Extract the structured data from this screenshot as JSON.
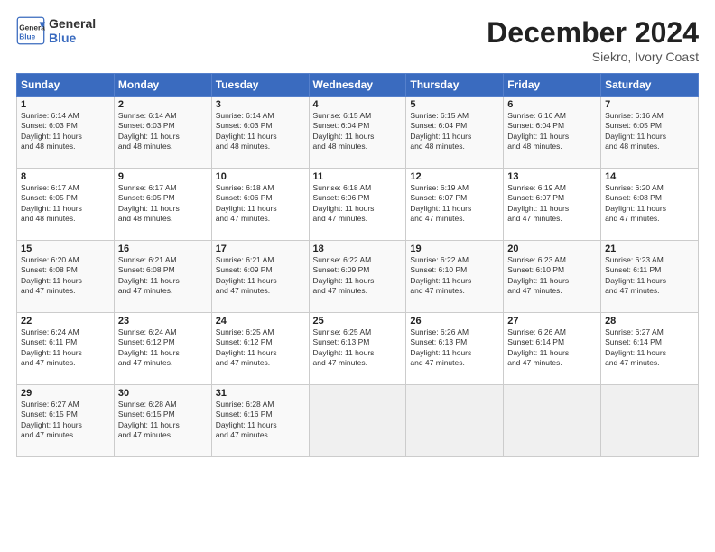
{
  "header": {
    "logo_line1": "General",
    "logo_line2": "Blue",
    "title": "December 2024",
    "subtitle": "Siekro, Ivory Coast"
  },
  "days_of_week": [
    "Sunday",
    "Monday",
    "Tuesday",
    "Wednesday",
    "Thursday",
    "Friday",
    "Saturday"
  ],
  "weeks": [
    [
      {
        "day": "1",
        "info": "Sunrise: 6:14 AM\nSunset: 6:03 PM\nDaylight: 11 hours\nand 48 minutes."
      },
      {
        "day": "2",
        "info": "Sunrise: 6:14 AM\nSunset: 6:03 PM\nDaylight: 11 hours\nand 48 minutes."
      },
      {
        "day": "3",
        "info": "Sunrise: 6:14 AM\nSunset: 6:03 PM\nDaylight: 11 hours\nand 48 minutes."
      },
      {
        "day": "4",
        "info": "Sunrise: 6:15 AM\nSunset: 6:04 PM\nDaylight: 11 hours\nand 48 minutes."
      },
      {
        "day": "5",
        "info": "Sunrise: 6:15 AM\nSunset: 6:04 PM\nDaylight: 11 hours\nand 48 minutes."
      },
      {
        "day": "6",
        "info": "Sunrise: 6:16 AM\nSunset: 6:04 PM\nDaylight: 11 hours\nand 48 minutes."
      },
      {
        "day": "7",
        "info": "Sunrise: 6:16 AM\nSunset: 6:05 PM\nDaylight: 11 hours\nand 48 minutes."
      }
    ],
    [
      {
        "day": "8",
        "info": "Sunrise: 6:17 AM\nSunset: 6:05 PM\nDaylight: 11 hours\nand 48 minutes."
      },
      {
        "day": "9",
        "info": "Sunrise: 6:17 AM\nSunset: 6:05 PM\nDaylight: 11 hours\nand 48 minutes."
      },
      {
        "day": "10",
        "info": "Sunrise: 6:18 AM\nSunset: 6:06 PM\nDaylight: 11 hours\nand 47 minutes."
      },
      {
        "day": "11",
        "info": "Sunrise: 6:18 AM\nSunset: 6:06 PM\nDaylight: 11 hours\nand 47 minutes."
      },
      {
        "day": "12",
        "info": "Sunrise: 6:19 AM\nSunset: 6:07 PM\nDaylight: 11 hours\nand 47 minutes."
      },
      {
        "day": "13",
        "info": "Sunrise: 6:19 AM\nSunset: 6:07 PM\nDaylight: 11 hours\nand 47 minutes."
      },
      {
        "day": "14",
        "info": "Sunrise: 6:20 AM\nSunset: 6:08 PM\nDaylight: 11 hours\nand 47 minutes."
      }
    ],
    [
      {
        "day": "15",
        "info": "Sunrise: 6:20 AM\nSunset: 6:08 PM\nDaylight: 11 hours\nand 47 minutes."
      },
      {
        "day": "16",
        "info": "Sunrise: 6:21 AM\nSunset: 6:08 PM\nDaylight: 11 hours\nand 47 minutes."
      },
      {
        "day": "17",
        "info": "Sunrise: 6:21 AM\nSunset: 6:09 PM\nDaylight: 11 hours\nand 47 minutes."
      },
      {
        "day": "18",
        "info": "Sunrise: 6:22 AM\nSunset: 6:09 PM\nDaylight: 11 hours\nand 47 minutes."
      },
      {
        "day": "19",
        "info": "Sunrise: 6:22 AM\nSunset: 6:10 PM\nDaylight: 11 hours\nand 47 minutes."
      },
      {
        "day": "20",
        "info": "Sunrise: 6:23 AM\nSunset: 6:10 PM\nDaylight: 11 hours\nand 47 minutes."
      },
      {
        "day": "21",
        "info": "Sunrise: 6:23 AM\nSunset: 6:11 PM\nDaylight: 11 hours\nand 47 minutes."
      }
    ],
    [
      {
        "day": "22",
        "info": "Sunrise: 6:24 AM\nSunset: 6:11 PM\nDaylight: 11 hours\nand 47 minutes."
      },
      {
        "day": "23",
        "info": "Sunrise: 6:24 AM\nSunset: 6:12 PM\nDaylight: 11 hours\nand 47 minutes."
      },
      {
        "day": "24",
        "info": "Sunrise: 6:25 AM\nSunset: 6:12 PM\nDaylight: 11 hours\nand 47 minutes."
      },
      {
        "day": "25",
        "info": "Sunrise: 6:25 AM\nSunset: 6:13 PM\nDaylight: 11 hours\nand 47 minutes."
      },
      {
        "day": "26",
        "info": "Sunrise: 6:26 AM\nSunset: 6:13 PM\nDaylight: 11 hours\nand 47 minutes."
      },
      {
        "day": "27",
        "info": "Sunrise: 6:26 AM\nSunset: 6:14 PM\nDaylight: 11 hours\nand 47 minutes."
      },
      {
        "day": "28",
        "info": "Sunrise: 6:27 AM\nSunset: 6:14 PM\nDaylight: 11 hours\nand 47 minutes."
      }
    ],
    [
      {
        "day": "29",
        "info": "Sunrise: 6:27 AM\nSunset: 6:15 PM\nDaylight: 11 hours\nand 47 minutes."
      },
      {
        "day": "30",
        "info": "Sunrise: 6:28 AM\nSunset: 6:15 PM\nDaylight: 11 hours\nand 47 minutes."
      },
      {
        "day": "31",
        "info": "Sunrise: 6:28 AM\nSunset: 6:16 PM\nDaylight: 11 hours\nand 47 minutes."
      },
      {
        "day": "",
        "info": ""
      },
      {
        "day": "",
        "info": ""
      },
      {
        "day": "",
        "info": ""
      },
      {
        "day": "",
        "info": ""
      }
    ]
  ]
}
